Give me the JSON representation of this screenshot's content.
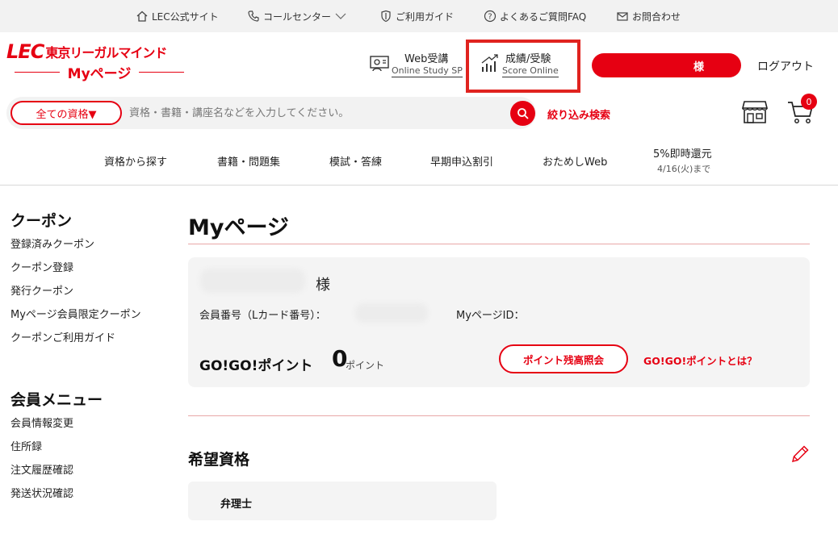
{
  "topbar": {
    "items": [
      {
        "label": "LEC公式サイト",
        "icon": "home-icon"
      },
      {
        "label": "コールセンター",
        "icon": "phone-icon"
      },
      {
        "label": "ご利用ガイド",
        "icon": "shield-icon"
      },
      {
        "label": "よくあるご質問FAQ",
        "icon": "question-icon"
      },
      {
        "label": "お問合わせ",
        "icon": "mail-icon"
      }
    ]
  },
  "header": {
    "logo_brand": "LEC",
    "logo_name": "東京リーガルマインド",
    "logo_sub": "Myページ",
    "web_study_title": "Web受講",
    "web_study_sub": "Online Study SP",
    "score_title": "成績/受験",
    "score_sub": "Score Online",
    "user_suffix": "様",
    "logout_label": "ログアウト"
  },
  "search": {
    "category_label": "全ての資格▼",
    "placeholder": "資格・書籍・講座名などを入力してください。",
    "refine_label": "絞り込み検索",
    "cart_count": "0"
  },
  "menu": {
    "items": [
      "資格から探す",
      "書籍・問題集",
      "模試・答練",
      "早期申込割引",
      "おためしWeb",
      "5%即時還元"
    ],
    "sub_note": "4/16(火)まで"
  },
  "sidebar": {
    "coupon_heading": "クーポン",
    "coupon_links": [
      "登録済みクーポン",
      "クーポン登録",
      "発行クーポン",
      "Myページ会員限定クーポン",
      "クーポンご利用ガイド"
    ],
    "member_heading": "会員メニュー",
    "member_links": [
      "会員情報変更",
      "住所録",
      "注文履歴確認",
      "発送状況確認"
    ]
  },
  "main": {
    "title": "Myページ",
    "name_suffix": "様",
    "member_no_label": "会員番号（Lカード番号）：",
    "mypage_id_label": "MyページID：",
    "points_label": "GO!GO!ポイント",
    "points_value": "0",
    "points_unit": "ポイント",
    "points_button": "ポイント残高照会",
    "points_about": "GO!GO!ポイントとは？",
    "wish_heading": "希望資格",
    "wish_items": [
      "弁理士"
    ]
  },
  "colors": {
    "brand_red": "#e60012",
    "highlight_box": "#e0231f"
  }
}
